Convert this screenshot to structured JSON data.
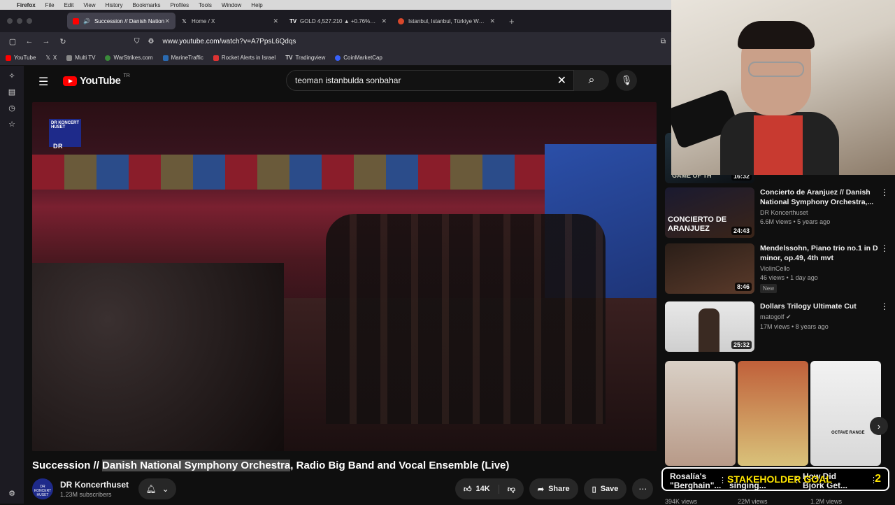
{
  "menubar": {
    "app": "Firefox",
    "items": [
      "File",
      "Edit",
      "View",
      "History",
      "Bookmarks",
      "Profiles",
      "Tools",
      "Window",
      "Help"
    ]
  },
  "tabs": [
    {
      "label": "Succession // Danish Nation",
      "icon": "youtube-icon",
      "active": true
    },
    {
      "label": "Home / X",
      "icon": "x-icon",
      "active": false
    },
    {
      "label": "GOLD 4,527.210 ▲ +0.76% Unna",
      "icon": "tradingview-icon",
      "active": false
    },
    {
      "label": "Istanbul, Istanbul, Türkiye Weat",
      "icon": "weather-icon",
      "active": false
    }
  ],
  "url": {
    "prefix": "www.",
    "host": "youtube.com",
    "path": "/watch?v=A7PpsL6Qdqs"
  },
  "bookmarks": [
    "YouTube",
    "X",
    "Multi TV",
    "WarStrikes.com",
    "MarineTraffic",
    "Rocket Alerts in Israel",
    "Tradingview",
    "CoinMarketCap"
  ],
  "youtube": {
    "logo_text": "YouTube",
    "region": "TR",
    "search_value": "teoman istanbulda sonbahar"
  },
  "player": {
    "channel_mark": "DR KONCERT HUSET",
    "channel_mark_sub": "DR"
  },
  "video": {
    "title_pre": "Succession // ",
    "title_hl": "Danish National Symphony Orchestra",
    "title_post": ", Radio Big Band and Vocal Ensemble (Live)",
    "channel": "DR Koncerthuset",
    "subscribers": "1.23M subscribers",
    "likes": "14K",
    "share": "Share",
    "save": "Save",
    "avatar_text": "DR KONCERT HUSET"
  },
  "recommendations": [
    {
      "title": "",
      "channel": "",
      "stats": "",
      "duration": "16:32",
      "thumb_text": "GAME OF TH"
    },
    {
      "title": "Concierto de Aranjuez // Danish National Symphony Orchestra,...",
      "channel": "DR Koncerthuset",
      "stats": "6.6M views • 5 years ago",
      "duration": "24:43",
      "thumb_text": "CONCIERTO DE ARANJUEZ"
    },
    {
      "title": "Mendelssohn, Piano trio no.1 in D minor, op.49, 4th mvt",
      "channel": "ViolinCello",
      "stats": "46 views • 1 day ago",
      "badge": "New",
      "duration": "8:46"
    },
    {
      "title": "Dollars Trilogy Ultimate Cut",
      "channel": "matogolf",
      "stats": "17M views • 8 years ago",
      "duration": "25:32"
    }
  ],
  "shorts": [
    {
      "caption": ""
    },
    {
      "caption": ""
    },
    {
      "caption": "OCTAVE RANGE"
    }
  ],
  "overlay": {
    "left1": "Rosalía's",
    "left2": "\"Berghain\"...",
    "mid2": "singing...",
    "right1": "How Did",
    "right2": "Bjork Get...",
    "center": "STAKEHOLDER GOAL",
    "num": "2",
    "views": [
      "394K views",
      "22M views",
      "1.2M views"
    ]
  }
}
